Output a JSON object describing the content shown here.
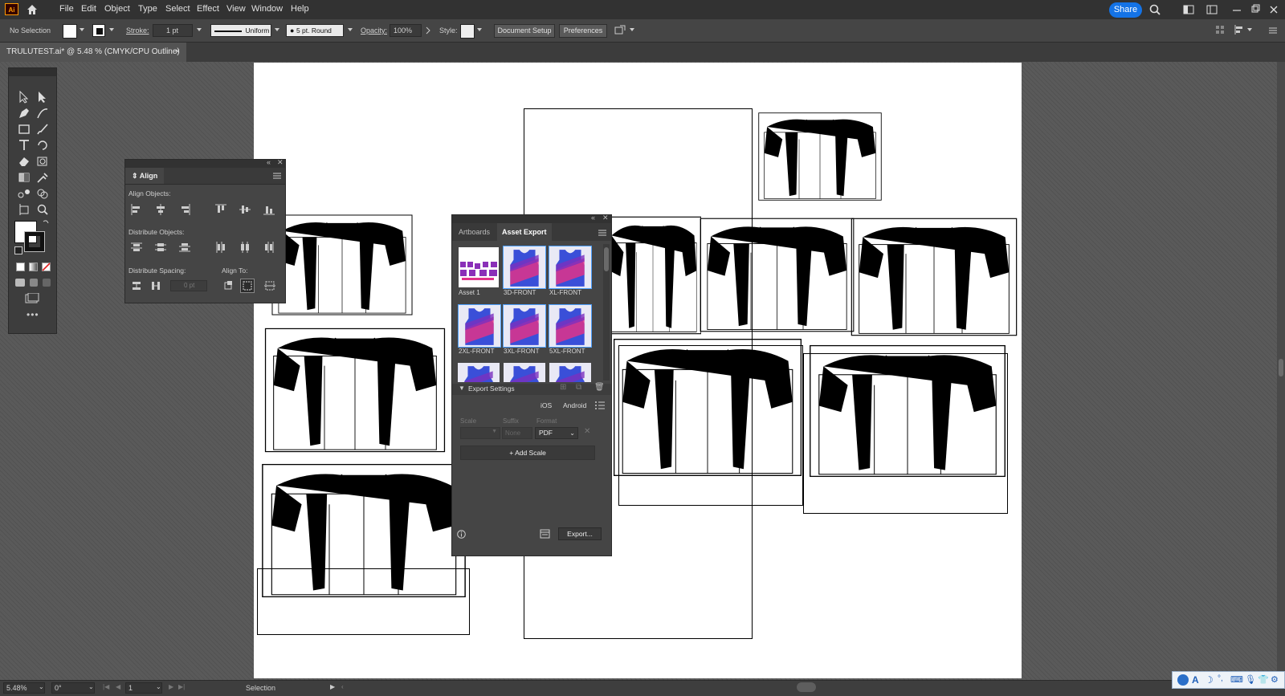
{
  "app": {
    "logo": "Ai"
  },
  "menu": [
    "File",
    "Edit",
    "Object",
    "Type",
    "Select",
    "Effect",
    "View",
    "Window",
    "Help"
  ],
  "share_label": "Share",
  "control": {
    "selection": "No Selection",
    "stroke_label": "Stroke:",
    "stroke_value": "1 pt",
    "uniform": "Uniform",
    "brush": "5 pt. Round",
    "opacity_label": "Opacity:",
    "opacity_value": "100%",
    "style_label": "Style:",
    "doc_setup": "Document Setup",
    "preferences": "Preferences"
  },
  "doc_tab": {
    "title": "TRULUTEST.ai* @ 5.48 % (CMYK/CPU Outline)",
    "close": "×"
  },
  "align_panel": {
    "title": "Align",
    "align_objects": "Align Objects:",
    "distribute_objects": "Distribute Objects:",
    "distribute_spacing": "Distribute Spacing:",
    "align_to": "Align To:",
    "spacing_value": "0 pt"
  },
  "asset_panel": {
    "tab_artboards": "Artboards",
    "tab_asset_export": "Asset Export",
    "assets": [
      "Asset 1",
      "3D-FRONT",
      "XL-FRONT",
      "2XL-FRONT",
      "3XL-FRONT",
      "5XL-FRONT"
    ],
    "export_settings": "Export Settings",
    "ios": "iOS",
    "android": "Android",
    "col_scale": "Scale",
    "col_suffix": "Suffix",
    "col_format": "Format",
    "suffix_placeholder": "None",
    "format": "PDF",
    "add_scale": "Add Scale",
    "export_btn": "Export..."
  },
  "status": {
    "zoom": "5.48%",
    "rotate": "0°",
    "artboard": "1",
    "tool": "Selection"
  },
  "colors": {
    "accent": "#1473e6",
    "ai_orange": "#ff9a00",
    "jersey_purple": "#7b2fbf",
    "jersey_pink": "#e0328a",
    "jersey_blue": "#3a4fd8"
  }
}
